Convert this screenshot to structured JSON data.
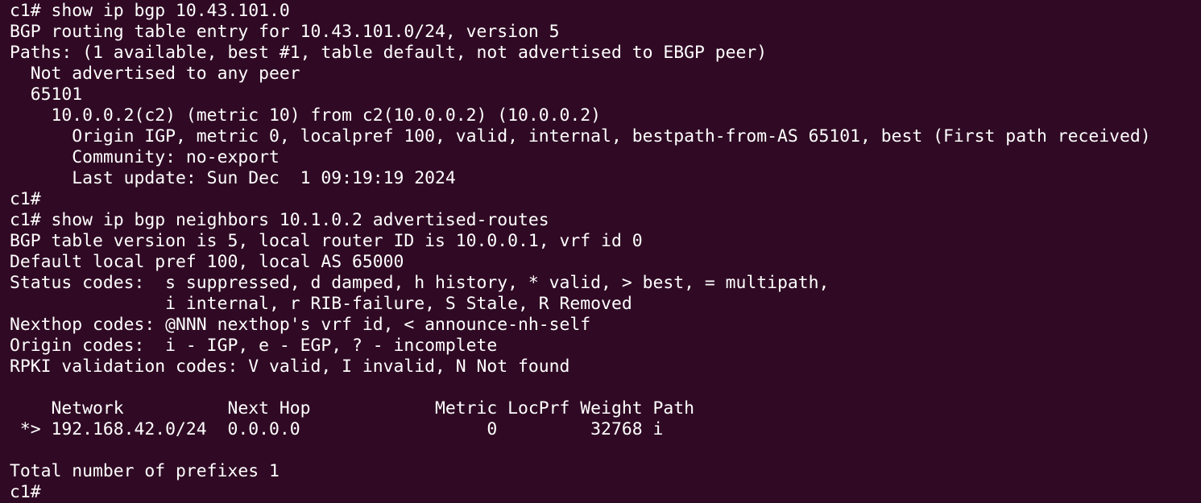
{
  "terminal": {
    "background": "#300a24",
    "foreground": "#ffffff",
    "lines": [
      "c1# show ip bgp 10.43.101.0",
      "BGP routing table entry for 10.43.101.0/24, version 5",
      "Paths: (1 available, best #1, table default, not advertised to EBGP peer)",
      "  Not advertised to any peer",
      "  65101",
      "    10.0.0.2(c2) (metric 10) from c2(10.0.0.2) (10.0.0.2)",
      "      Origin IGP, metric 0, localpref 100, valid, internal, bestpath-from-AS 65101, best (First path received)",
      "      Community: no-export",
      "      Last update: Sun Dec  1 09:19:19 2024",
      "c1#",
      "c1# show ip bgp neighbors 10.1.0.2 advertised-routes",
      "BGP table version is 5, local router ID is 10.0.0.1, vrf id 0",
      "Default local pref 100, local AS 65000",
      "Status codes:  s suppressed, d damped, h history, * valid, > best, = multipath,",
      "               i internal, r RIB-failure, S Stale, R Removed",
      "Nexthop codes: @NNN nexthop's vrf id, < announce-nh-self",
      "Origin codes:  i - IGP, e - EGP, ? - incomplete",
      "RPKI validation codes: V valid, I invalid, N Not found",
      "",
      "    Network          Next Hop            Metric LocPrf Weight Path",
      " *> 192.168.42.0/24  0.0.0.0                  0         32768 i",
      "",
      "Total number of prefixes 1",
      "c1#"
    ]
  }
}
